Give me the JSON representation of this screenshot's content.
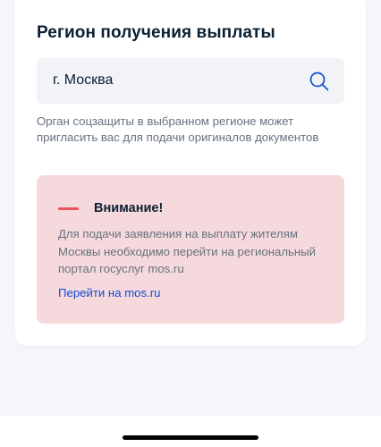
{
  "region": {
    "title": "Регион получения выплаты",
    "search": {
      "value": "г. Москва"
    },
    "hint": "Орган соцзащиты в выбранном регионе может пригласить вас для подачи оригиналов документов"
  },
  "alert": {
    "title": "Внимание!",
    "text": "Для подачи заявления на выплату жителям Москвы необходимо перейти на региональный портал госуслуг mos.ru",
    "link": "Перейти на mos.ru"
  },
  "colors": {
    "alert_background": "#f6d9dc",
    "alert_accent": "#e8505b",
    "link": "#0d4cd3",
    "search_icon": "#0d4cd3"
  },
  "icons": {
    "search": "search-icon"
  }
}
